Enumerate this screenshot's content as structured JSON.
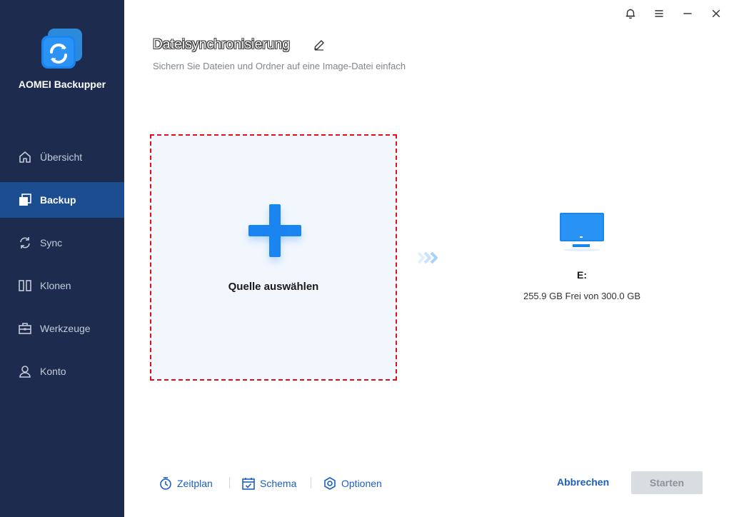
{
  "app": {
    "name": "AOMEI Backupper"
  },
  "sidebar": {
    "items": [
      {
        "label": "Übersicht",
        "icon": "home-icon",
        "active": false
      },
      {
        "label": "Backup",
        "icon": "backup-icon",
        "active": true
      },
      {
        "label": "Sync",
        "icon": "sync-icon",
        "active": false
      },
      {
        "label": "Klonen",
        "icon": "clone-icon",
        "active": false
      },
      {
        "label": "Werkzeuge",
        "icon": "toolbox-icon",
        "active": false
      },
      {
        "label": "Konto",
        "icon": "user-icon",
        "active": false
      }
    ]
  },
  "window_controls": [
    "bell-icon",
    "menu-icon",
    "minimize-icon",
    "close-icon"
  ],
  "header": {
    "title": "Dateisynchronisierung",
    "subtitle": "Sichern Sie Dateien und Ordner auf eine Image-Datei einfach"
  },
  "source": {
    "label": "Quelle auswählen"
  },
  "destination": {
    "drive": "E:",
    "space": "255.9 GB Frei von 300.0 GB"
  },
  "toolbar": {
    "schedule_label": "Zeitplan",
    "scheme_label": "Schema",
    "options_label": "Optionen",
    "cancel_label": "Abbrechen",
    "start_label": "Starten"
  },
  "colors": {
    "sidebar_bg": "#1c2b4e",
    "sidebar_active": "#1d4d91",
    "accent": "#1a84f0",
    "link": "#1b5fbf",
    "dashed_border": "#e0101a"
  }
}
